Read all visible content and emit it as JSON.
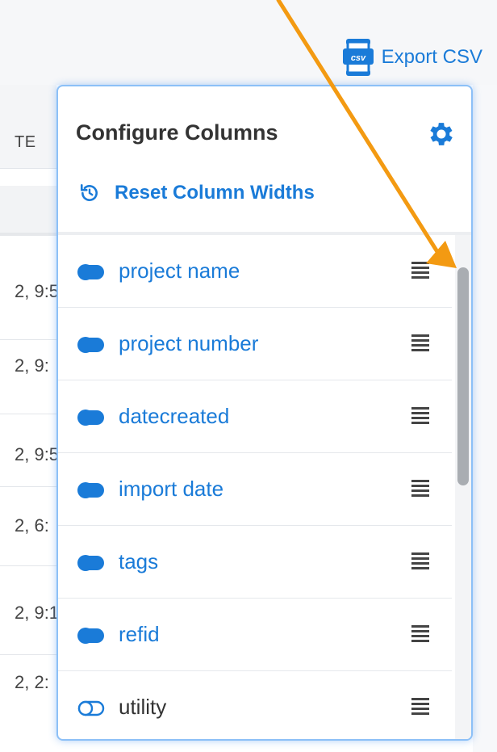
{
  "toolbar": {
    "export_label": "Export CSV",
    "csv_badge": "csv",
    "icon": "csv-file-icon"
  },
  "table": {
    "header_fragment": "TE",
    "rows": [
      "2, 9:5",
      "2, 9:",
      "2, 9:5",
      "2, 6:",
      "2, 9:1",
      "2, 2:"
    ]
  },
  "popover": {
    "title": "Configure Columns",
    "settings_icon": "gear-icon",
    "reset_label": "Reset Column Widths",
    "reset_icon": "reset-icon",
    "columns": [
      {
        "label": "project name",
        "enabled": true
      },
      {
        "label": "project number",
        "enabled": true
      },
      {
        "label": "datecreated",
        "enabled": true
      },
      {
        "label": "import date",
        "enabled": true
      },
      {
        "label": "tags",
        "enabled": true
      },
      {
        "label": "refid",
        "enabled": true
      },
      {
        "label": "utility",
        "enabled": false
      }
    ],
    "drag_icon": "drag-handle-icon"
  },
  "colors": {
    "accent": "#1a7bd8",
    "annotation_arrow": "#f39a12",
    "popover_border": "#8cc0f7"
  }
}
